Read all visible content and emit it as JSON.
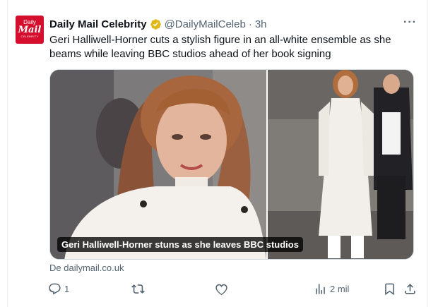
{
  "tweet": {
    "display_name": "Daily Mail Celebrity",
    "handle": "@DailyMailCeleb",
    "separator": "·",
    "time": "3h",
    "more_label": "···",
    "text": "Geri Halliwell-Horner cuts a stylish figure in an all-white ensemble as she beams while leaving BBC studios ahead of her book signing",
    "avatar": {
      "line1": "Daily",
      "line2": "Mail",
      "line3": "CELEBRITY",
      "color": "#d50e2d"
    },
    "verified_color": "#e2b719"
  },
  "media": {
    "caption": "Geri Halliwell-Horner stuns as she leaves BBC studios",
    "source": "De dailymail.co.uk"
  },
  "actions": {
    "reply_count": "1",
    "views_count": "2 mil",
    "icons": [
      "reply-icon",
      "retweet-icon",
      "like-icon",
      "views-icon",
      "bookmark-icon",
      "share-icon"
    ]
  }
}
